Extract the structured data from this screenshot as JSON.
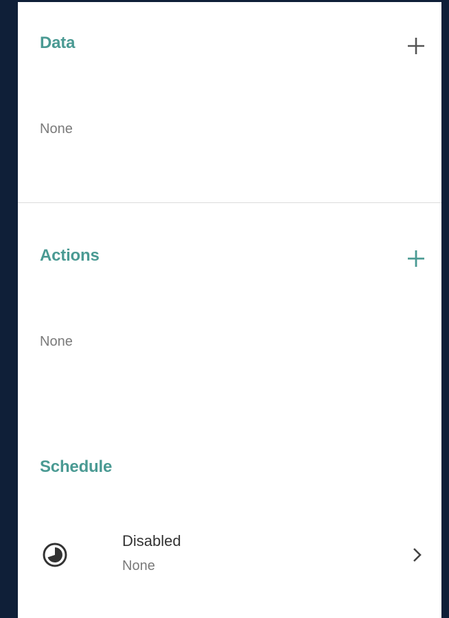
{
  "data_section": {
    "title": "Data",
    "empty_text": "None",
    "add_icon": "plus-icon",
    "add_color": "#555555"
  },
  "actions_section": {
    "title": "Actions",
    "empty_text": "None",
    "add_icon": "plus-icon",
    "add_color": "#4a9a93"
  },
  "schedule_section": {
    "title": "Schedule",
    "item": {
      "icon": "schedule-clock-icon",
      "title": "Disabled",
      "subtitle": "None",
      "trailing_icon": "chevron-right-icon"
    }
  },
  "colors": {
    "accent": "#4a9a93",
    "background": "#0f1f38",
    "panel": "#ffffff"
  }
}
